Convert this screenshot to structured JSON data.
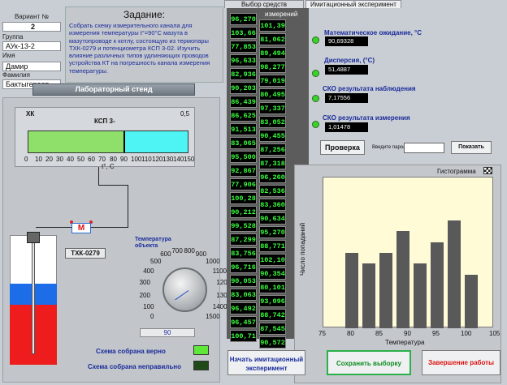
{
  "tabs": {
    "tab1": "Выбор средств измерения",
    "tab2": "Имитационный эксперимент"
  },
  "student": {
    "variant_label": "Вариант №",
    "variant_value": "2",
    "group_label": "Группа",
    "group_value": "АУк-13-2",
    "name_label": "Имя",
    "name_value": "Дамир",
    "surname_label": "Фамилия",
    "surname_value": "Бактыгереев"
  },
  "task": {
    "title": "Задание:",
    "text": "Собрать схему измерительного канала для измерения температуры t°=90°С мазута в мазутопроводе к котлу, состоящую из термопары ТХК-0279 и потенциометра КСП 3-02. Изучить влияние различных типов удлиняющих проводов устройства КТ на погрешность канала измерения температуры."
  },
  "stand": {
    "title": "Лабораторный стенд",
    "xk": "ХК",
    "accuracy": "0,5",
    "device": "КСП 3-",
    "bar_unit": "t°, С",
    "ticks": [
      "0",
      "10",
      "20",
      "30",
      "40",
      "50",
      "60",
      "70",
      "80",
      "90",
      "100",
      "110",
      "120",
      "130",
      "140",
      "150"
    ],
    "bar_value": 90,
    "m_label": "М",
    "thermocouple": "ТХК-0279",
    "object_temp_label": "Температура объекта",
    "knob_ticks": [
      "0",
      "100",
      "200",
      "300",
      "400",
      "500",
      "600",
      "700",
      "800",
      "900",
      "1000",
      "1100",
      "1200",
      "1300",
      "1400",
      "1500"
    ],
    "knob_value": "90",
    "schema_ok": "Схема собрана верно",
    "schema_bad": "Схема собрана неправильно"
  },
  "measure_header": "измерений",
  "measurements_col1": [
    "96,270",
    "103,66",
    "77,853",
    "96,633",
    "82,936",
    "90,203",
    "86,439",
    "86,625",
    "91,513",
    "83,065",
    "95,500",
    "92,867",
    "77,906",
    "100,28",
    "90,212",
    "99,528",
    "87,299",
    "83,756",
    "96,716",
    "90,053",
    "83,063",
    "96,492",
    "96,457",
    "100,71"
  ],
  "measurements_col2": [
    "101,39",
    "81,062",
    "89,494",
    "98,277",
    "79,019",
    "80,495",
    "97,337",
    "83,052",
    "90,455",
    "87,256",
    "87,318",
    "96,260",
    "82,536",
    "83,360",
    "90,634",
    "95,270",
    "88,771",
    "102,10",
    "90,354",
    "80,101",
    "93,096",
    "88,742",
    "87,545",
    "90,572"
  ],
  "stats": {
    "mean_label": "Математическое ожидание, °С",
    "mean_value": "90,69328",
    "disp_label": "Дисперсия, (°С)",
    "disp_value": "51,4887",
    "sko_obs_label": "СКО результата наблюдения",
    "sko_obs_value": "7,17556",
    "sko_meas_label": "СКО результата измерения",
    "sko_meas_value": "1,01478"
  },
  "check_button": "Проверка",
  "password_label": "Введите пароль",
  "password_value": "",
  "show_button": "Показать",
  "histogram_title": "Гистограмма",
  "start_button": "Начать имитационный эксперимент",
  "save_button": "Сохранить выборку",
  "finish_button": "Завершение работы",
  "colors": {
    "led_green": "#39d42a",
    "finish_text": "#e01010",
    "save_text": "#0c8a1e",
    "start_text": "#1a2b9a"
  },
  "chart_data": {
    "type": "bar",
    "xlabel": "Температура",
    "ylabel": "Число попаданий",
    "xlim": [
      75,
      105
    ],
    "xticks": [
      "75",
      "80",
      "85",
      "90",
      "95",
      "100",
      "105"
    ],
    "categories": [
      80,
      83,
      86,
      89,
      92,
      95,
      98,
      101
    ],
    "values": [
      7,
      6,
      7,
      9,
      6,
      8,
      10,
      5
    ],
    "ylim": [
      0,
      14
    ],
    "grid": false
  }
}
